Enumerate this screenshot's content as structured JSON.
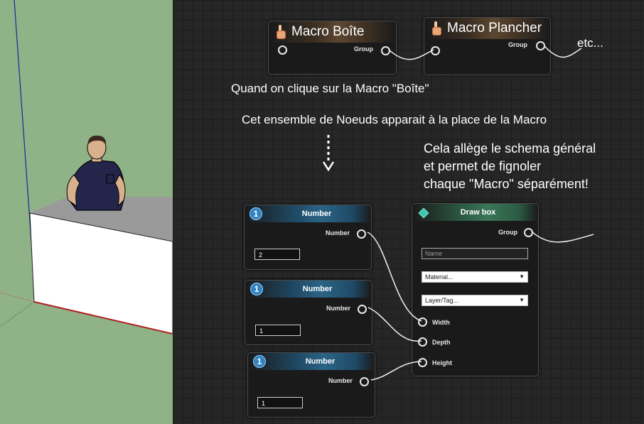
{
  "macros": [
    {
      "title": "Macro Boîte",
      "output_label": "Group"
    },
    {
      "title": "Macro Plancher",
      "output_label": "Group"
    }
  ],
  "etc_label": "etc...",
  "annotations": {
    "click_text": "Quand on clique sur la Macro \"Boîte\"",
    "appear_text": "Cet ensemble de Noeuds apparait à la place de la Macro",
    "benefit_lines": [
      "Cela allège le schema général",
      "et permet de fignoler",
      "chaque \"Macro\" séparément!"
    ]
  },
  "number_nodes": [
    {
      "badge": "1",
      "title": "Number",
      "output_label": "Number",
      "value": "2"
    },
    {
      "badge": "1",
      "title": "Number",
      "output_label": "Number",
      "value": "1"
    },
    {
      "badge": "1",
      "title": "Number",
      "output_label": "Number",
      "value": "1"
    }
  ],
  "draw_box": {
    "title": "Draw box",
    "output_label": "Group",
    "name_placeholder": "Name",
    "material_select": "Material...",
    "layer_select": "Layer/Tag...",
    "inputs": [
      "Width",
      "Depth",
      "Height"
    ]
  },
  "icons": {
    "macro": "hand-pointer-icon",
    "number": "number-badge-icon",
    "draw_box": "cube-icon"
  },
  "colors": {
    "sky": "#8fb287",
    "graph_bg": "#262626",
    "number_header": "#2b6486",
    "drawbox_header": "#3b7658",
    "macro_header": "#5c4630"
  }
}
